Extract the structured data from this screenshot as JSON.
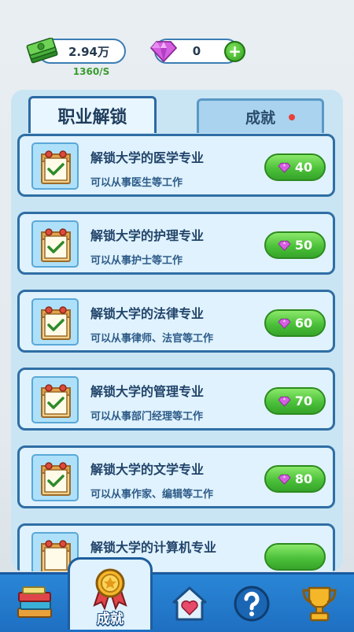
{
  "top_bar": {
    "cash_amount": "2.94万",
    "cash_rate": "1360/S",
    "gem_amount": "0",
    "plus_label": "+"
  },
  "tabs": [
    {
      "label": "职业解锁",
      "active": true
    },
    {
      "label": "成就",
      "active": false,
      "has_notification": true
    }
  ],
  "unlock_items": [
    {
      "title": "解锁大学的医学专业",
      "subtitle": "可以从事医生等工作",
      "price": "40"
    },
    {
      "title": "解锁大学的护理专业",
      "subtitle": "可以从事护士等工作",
      "price": "50"
    },
    {
      "title": "解锁大学的法律专业",
      "subtitle": "可以从事律师、法官等工作",
      "price": "60"
    },
    {
      "title": "解锁大学的管理专业",
      "subtitle": "可以从事部门经理等工作",
      "price": "70"
    },
    {
      "title": "解锁大学的文学专业",
      "subtitle": "可以从事作家、编辑等工作",
      "price": "80"
    },
    {
      "title": "解锁大学的计算机专业",
      "subtitle": "",
      "price": ""
    }
  ],
  "bottom_nav": {
    "items": [
      {
        "name": "books-nav",
        "icon": "books-icon"
      },
      {
        "name": "achievement-nav",
        "icon": "medal-icon",
        "label": "成就",
        "active": true
      },
      {
        "name": "home-nav",
        "icon": "house-heart-icon"
      },
      {
        "name": "help-nav",
        "icon": "question-icon"
      },
      {
        "name": "trophy-nav",
        "icon": "trophy-icon"
      }
    ]
  },
  "colors": {
    "accent_blue": "#2f6ea5",
    "button_green": "#4cc13a",
    "gem_purple": "#c94fd8",
    "notification_red": "#e8413a"
  }
}
